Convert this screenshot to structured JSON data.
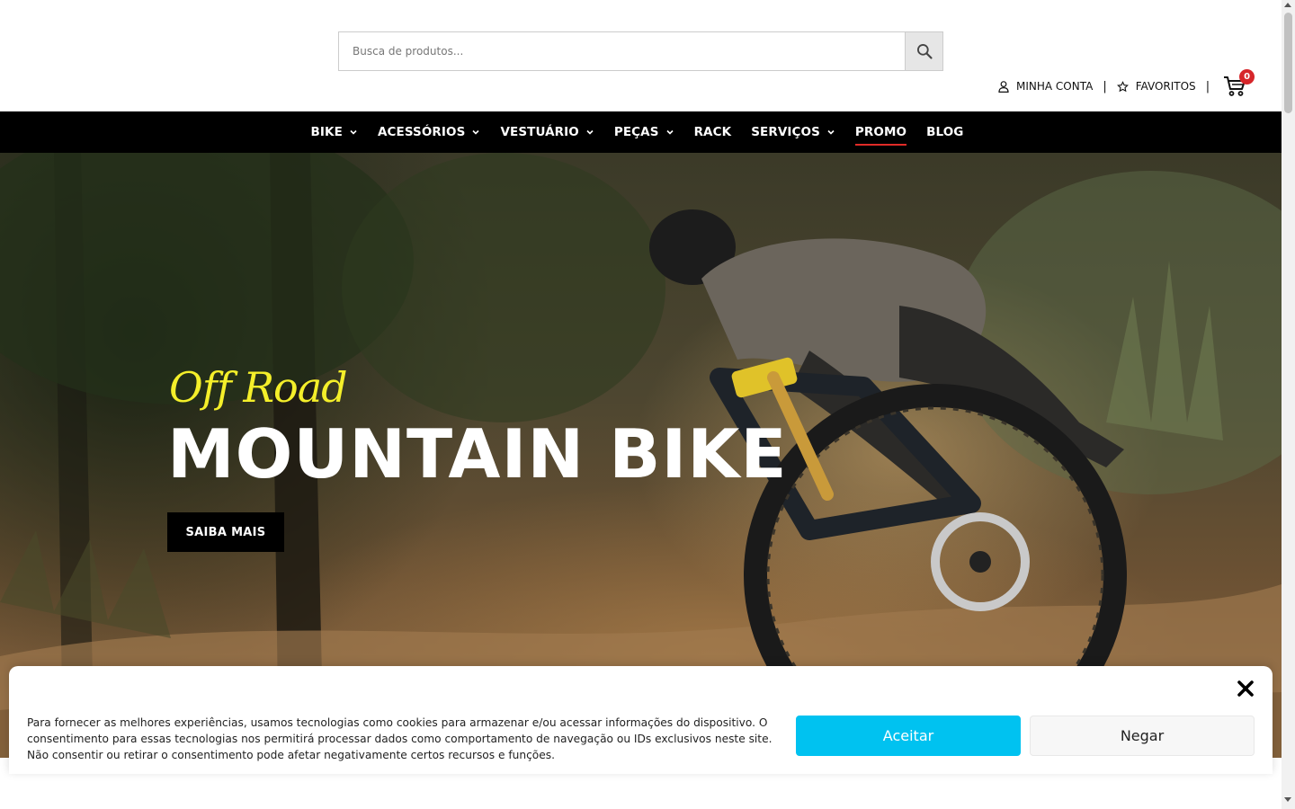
{
  "search": {
    "placeholder": "Busca de produtos..."
  },
  "account": {
    "my_account": "MINHA CONTA",
    "separator": "|",
    "favorites": "FAVORITOS",
    "cart_count": "0"
  },
  "nav": {
    "items": [
      {
        "label": "BIKE",
        "dropdown": true
      },
      {
        "label": "ACESSÓRIOS",
        "dropdown": true
      },
      {
        "label": "VESTUÁRIO",
        "dropdown": true
      },
      {
        "label": "PEÇAS",
        "dropdown": true
      },
      {
        "label": "RACK",
        "dropdown": false
      },
      {
        "label": "SERVIÇOS",
        "dropdown": true
      },
      {
        "label": "PROMO",
        "dropdown": false,
        "active": true
      },
      {
        "label": "BLOG",
        "dropdown": false
      }
    ]
  },
  "hero": {
    "script": "Off Road",
    "title": "MOUNTAIN BIKE",
    "button": "SAIBA MAIS"
  },
  "cookie": {
    "text": "Para fornecer as melhores experiências, usamos tecnologias como cookies para armazenar e/ou acessar informações do dispositivo. O consentimento para essas tecnologias nos permitirá processar dados como comportamento de navegação ou IDs exclusivos neste site. Não consentir ou retirar o consentimento pode afetar negativamente certos recursos e funções.",
    "accept": "Aceitar",
    "deny": "Negar"
  },
  "colors": {
    "accent_yellow": "#f4ef2a",
    "accept_button": "#00c2f0",
    "badge_red": "#d6262a",
    "nav_underline": "#e02b27"
  }
}
